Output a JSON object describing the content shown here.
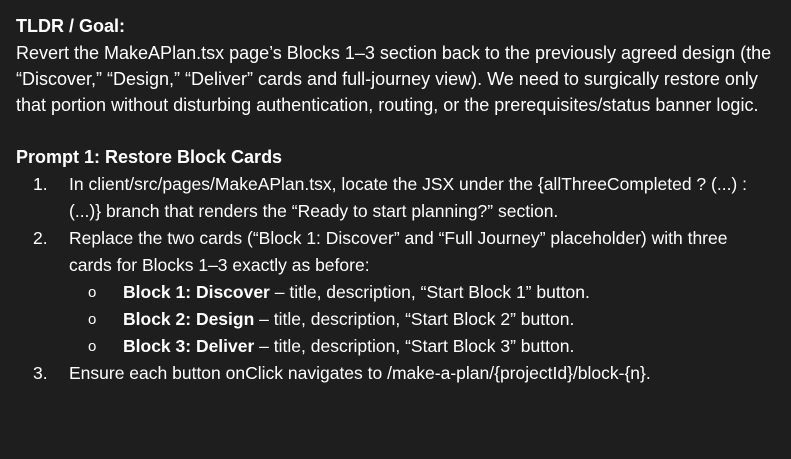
{
  "tldr": {
    "heading": "TLDR / Goal:",
    "body": "Revert the MakeAPlan.tsx page’s Blocks 1–3 section back to the previously agreed design (the “Discover,” “Design,” “Deliver” cards and full-journey view). We need to surgically restore only that portion without disturbing authentication, routing, or the prerequisites/status banner logic."
  },
  "prompt1": {
    "heading": "Prompt 1: Restore Block Cards",
    "steps": [
      {
        "number": "1.",
        "text": "In client/src/pages/MakeAPlan.tsx, locate the JSX under the {allThreeCompleted ? (...) : (...)} branch that renders the “Ready to start planning?” section."
      },
      {
        "number": "2.",
        "text": "Replace the two cards (“Block 1: Discover” and “Full Journey” placeholder) with three cards for Blocks 1–3 exactly as before:",
        "bullet_symbol": "o",
        "subitems": [
          {
            "title": "Block 1: Discover",
            "rest": " – title, description, “Start Block 1” button."
          },
          {
            "title": "Block 2: Design",
            "rest": " – title, description, “Start Block 2” button."
          },
          {
            "title": "Block 3: Deliver",
            "rest": " – title, description, “Start Block 3” button."
          }
        ]
      },
      {
        "number": "3.",
        "text": "Ensure each button onClick navigates to /make-a-plan/{projectId}/block-{n}."
      }
    ]
  }
}
